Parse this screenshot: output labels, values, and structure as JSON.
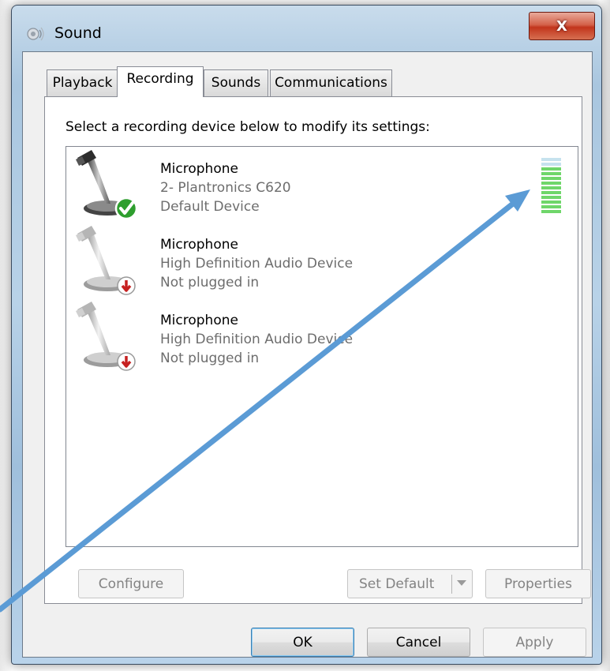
{
  "window": {
    "title": "Sound",
    "close_glyph": "X"
  },
  "tabs": [
    {
      "label": "Playback",
      "selected": false
    },
    {
      "label": "Recording",
      "selected": true
    },
    {
      "label": "Sounds",
      "selected": false
    },
    {
      "label": "Communications",
      "selected": false
    }
  ],
  "recording": {
    "instruction": "Select a recording device below to modify its settings:",
    "devices": [
      {
        "name": "Microphone",
        "description": "2- Plantronics C620",
        "status": "Default Device",
        "badge": "green-check-icon"
      },
      {
        "name": "Microphone",
        "description": "High Definition Audio Device",
        "status": "Not plugged in",
        "badge": "red-down-arrow-icon"
      },
      {
        "name": "Microphone",
        "description": "High Definition Audio Device",
        "status": "Not plugged in",
        "badge": "red-down-arrow-icon"
      }
    ],
    "level_meter": {
      "segments_total": 12,
      "segments_active": 10,
      "active_color": "#6fd66a",
      "inactive_color": "#c6e2ee"
    }
  },
  "buttons": {
    "configure": "Configure",
    "set_default": "Set Default",
    "properties": "Properties",
    "ok": "OK",
    "cancel": "Cancel",
    "apply": "Apply"
  },
  "colors": {
    "annotation_arrow": "#5b9bd5",
    "close_button": "#c7402a"
  }
}
